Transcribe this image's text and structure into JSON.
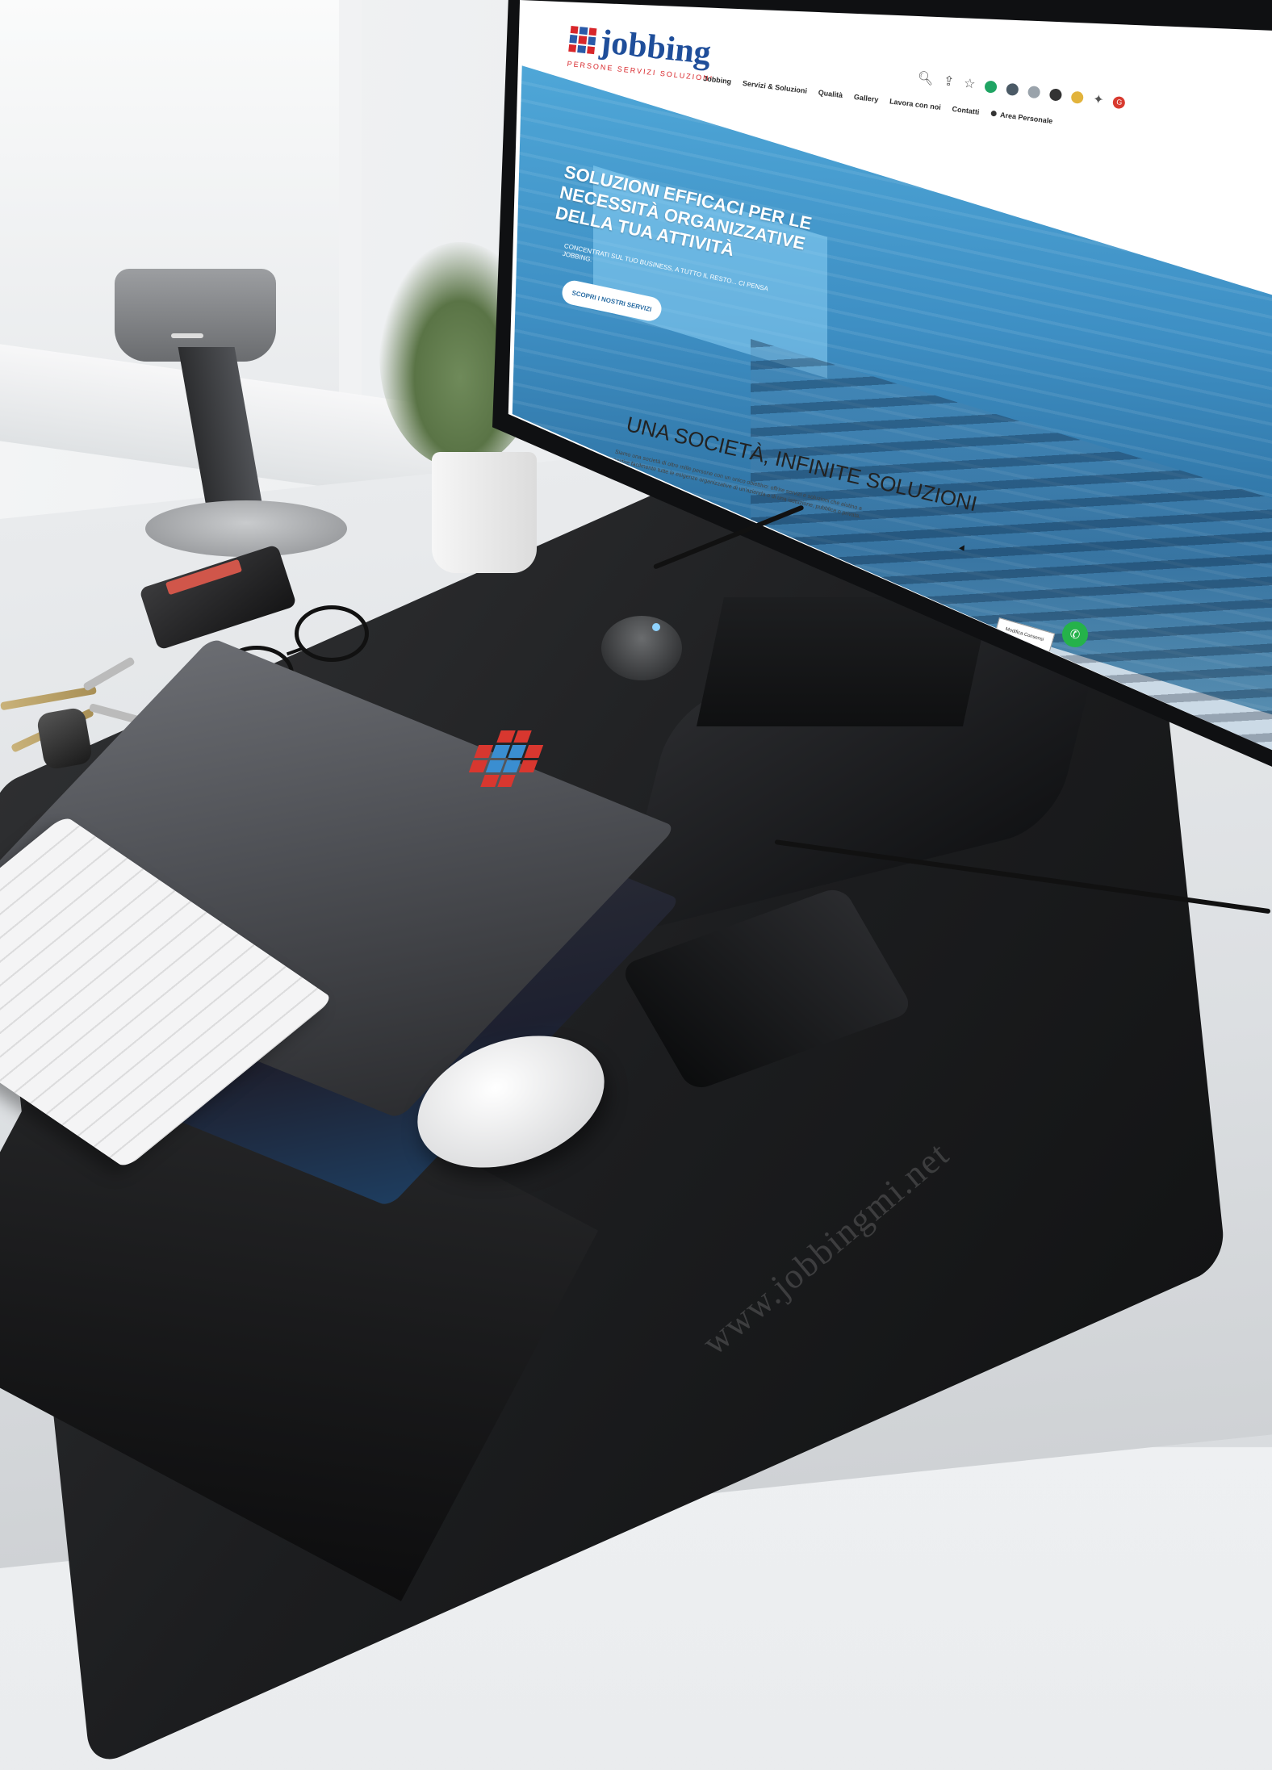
{
  "site": {
    "logo": {
      "name": "jobbing",
      "tagline": "PERSONE SERVIZI SOLUZIONI"
    },
    "nav": {
      "items": [
        "Jobbing",
        "Servizi & Soluzioni",
        "Qualità",
        "Gallery",
        "Lavora con noi",
        "Contatti"
      ],
      "account": "Area Personale"
    },
    "hero": {
      "title": "Soluzioni efficaci per le necessità organizzative della tua attività",
      "subtitle": "Concentrati sul tuo business, a tutto il resto... ci pensa Jobbing.",
      "button": "Scopri i nostri servizi"
    },
    "section": {
      "title": "Una società, infinite soluzioni",
      "text": "Siamo una società di oltre mille persone con un unico obiettivo: offrire servizi e soluzioni che aiutino a gestire facilmente tutte le esigenze organizzative di un'azienda o di una istituzione, pubblica o privata."
    },
    "cookie_button": "Modifica Consensi",
    "whatsapp_icon": "whatsapp-icon"
  },
  "browser": {
    "icons": [
      "zoom-icon",
      "share-icon",
      "bookmark-star-icon",
      "extension-icons",
      "puzzle-icon",
      "profile-avatar"
    ],
    "profile_initial": "G"
  },
  "watermark": "www.jobbingmi.net",
  "colors": {
    "brand_blue": "#1f4e9a",
    "brand_red": "#d8262a",
    "hero_blue": "#3e8fc4",
    "whatsapp_green": "#25b24a"
  }
}
